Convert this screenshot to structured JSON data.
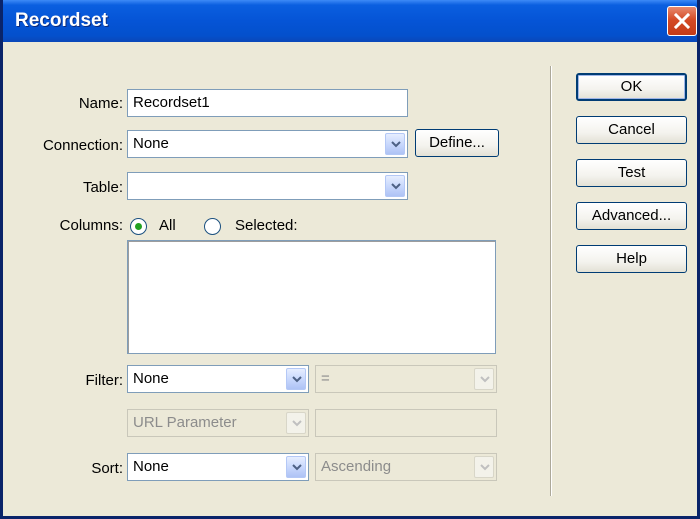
{
  "window": {
    "title": "Recordset"
  },
  "form": {
    "name_label": "Name:",
    "name_value": "Recordset1",
    "connection_label": "Connection:",
    "connection_value": "None",
    "define_button": "Define...",
    "table_label": "Table:",
    "table_value": "",
    "columns_label": "Columns:",
    "columns_all": "All",
    "columns_selected": "Selected:",
    "filter_label": "Filter:",
    "filter_value": "None",
    "filter_operator": "=",
    "filter_param_type": "URL Parameter",
    "filter_param_value": "",
    "sort_label": "Sort:",
    "sort_value": "None",
    "sort_order": "Ascending"
  },
  "buttons": {
    "ok": "OK",
    "cancel": "Cancel",
    "test": "Test",
    "advanced": "Advanced...",
    "help": "Help"
  },
  "icons": [
    "close-icon",
    "dropdown-arrow-icon",
    "radio-selected-icon",
    "radio-unselected-icon"
  ]
}
